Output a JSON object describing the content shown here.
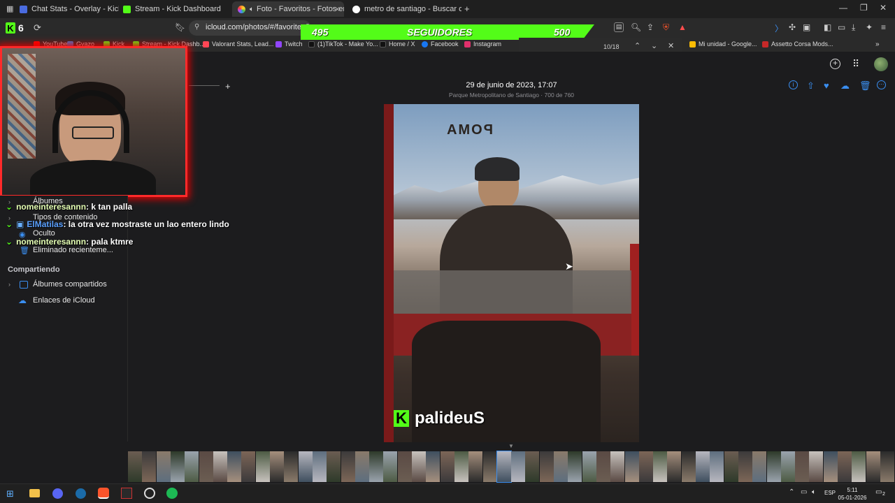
{
  "tabs": [
    {
      "label": "Chat Stats - Overlay - KickTools",
      "color": "#4a6bdf"
    },
    {
      "label": "Stream - Kick Dashboard",
      "color": "#53fc18"
    },
    {
      "label": "Foto - Favoritos - Fotos en iC",
      "color": "#ff9f2a",
      "active": true
    },
    {
      "label": "metro de santiago - Buscar con Goog",
      "color": "#ffffff"
    }
  ],
  "window": {
    "minimize": "—",
    "restore": "❐",
    "close": "✕"
  },
  "address": {
    "url": "icloud.com/photos/#/favorites/i.n",
    "kick_badge": "6"
  },
  "followers": {
    "current": "495",
    "label": "SEGUIDORES",
    "goal": "500"
  },
  "find": {
    "count": "10/18"
  },
  "bookmarks": [
    {
      "label": "YouTube",
      "color": "#ff0000"
    },
    {
      "label": "Gyazo",
      "color": "#3a7bd5"
    },
    {
      "label": "Kick",
      "color": "#53fc18"
    },
    {
      "label": "Stream - Kick Dashb...",
      "color": "#53fc18"
    },
    {
      "label": "Valorant Stats, Lead...",
      "color": "#ff4655"
    },
    {
      "label": "Twitch",
      "color": "#9146ff"
    },
    {
      "label": "(1)TikTok - Make Yo...",
      "color": "#111111"
    },
    {
      "label": "Home / X",
      "color": "#111111"
    },
    {
      "label": "Facebook",
      "color": "#1877f2"
    },
    {
      "label": "Instagram",
      "color": "#e1306c"
    },
    {
      "label": "Mi unidad - Google...",
      "color": "#fbbc04"
    },
    {
      "label": "Assetto Corsa Mods...",
      "color": "#c62828"
    }
  ],
  "photo": {
    "date": "29 de junio de 2023, 17:07",
    "location": "Parque Metropolitano de Santiago · 700 de 760",
    "sign": "POMA",
    "watermark": "palideuS"
  },
  "sidebar": {
    "items": [
      "Álbumes",
      "Tipos de contenido",
      "Oculto",
      "Eliminado recienteme..."
    ],
    "section": "Compartiendo",
    "shared": [
      "Álbumes compartidos",
      "Enlaces de iCloud"
    ]
  },
  "chat": [
    {
      "user": "nomeinteresannn",
      "msg": ": k tan palla"
    },
    {
      "user": "ElMatilas",
      "msg": ": la otra vez mostraste un lao entero lindo"
    },
    {
      "user": "nomeinteresannn",
      "msg": ": pala ktmre"
    }
  ],
  "taskbar": {
    "lang": "ESP",
    "time": "5:11",
    "date": "05-01-2026",
    "notifications": "2"
  },
  "colors": {
    "kick_green": "#53fc18",
    "icloud_blue": "#3a8ef0",
    "overlay_red": "#ff2a2a"
  }
}
